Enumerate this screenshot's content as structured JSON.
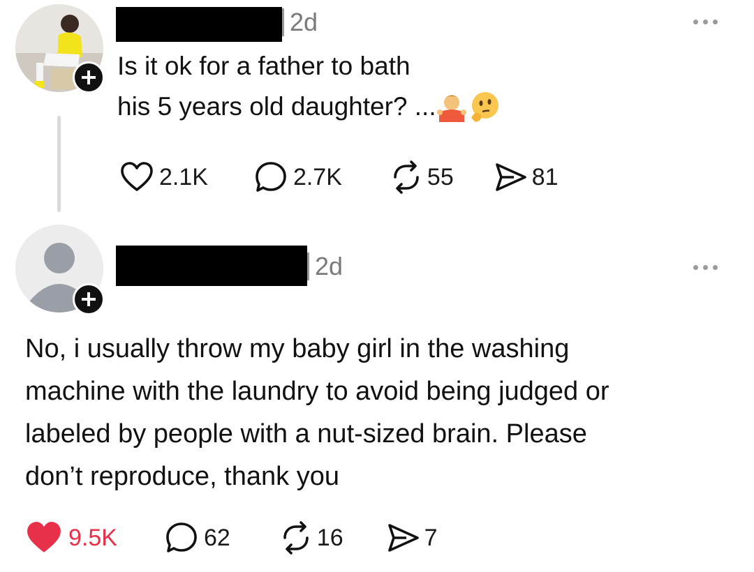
{
  "post": {
    "time": "2d",
    "text_line1": "Is it ok for a father to bath",
    "text_line2": "his 5 years old daughter? ...",
    "emojis": [
      "person-shrugging-emoji",
      "thinking-face-emoji"
    ],
    "likes": "2.1K",
    "replies": "2.7K",
    "reposts": "55",
    "shares": "81"
  },
  "reply": {
    "time": "2d",
    "text_line1": "No, i usually throw my baby girl in the washing",
    "text_line2": "machine with the laundry to avoid being judged or",
    "text_line3": "labeled by people with a nut-sized brain. Please",
    "text_line4": "don’t reproduce, thank you",
    "likes": "9.5K",
    "liked": true,
    "replies": "62",
    "reposts": "16",
    "shares": "7"
  },
  "colors": {
    "liked": "#e8304a",
    "badge": "#111111",
    "timestamp": "#7a7a7a"
  }
}
